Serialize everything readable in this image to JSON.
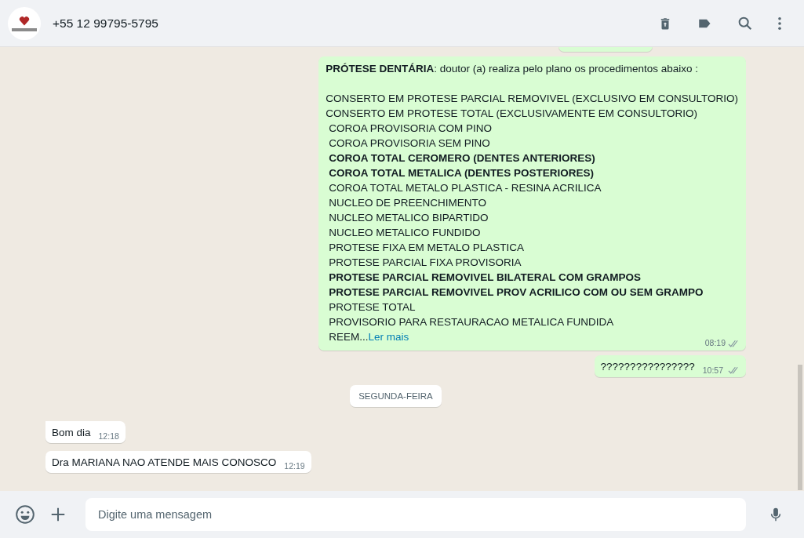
{
  "header": {
    "contact": "+55 12 99795-5795"
  },
  "messages": [
    {
      "kind": "cut"
    },
    {
      "kind": "long",
      "heading": "**PRÓTESE DENTÁRIA**: doutor (a) realiza pelo plano os procedimentos abaixo :",
      "lines": [
        {
          "text": "CONSERTO EM PROTESE PARCIAL REMOVIVEL (EXCLUSIVO EM CONSULTORIO)",
          "bold": false,
          "indent": false
        },
        {
          "text": "CONSERTO EM PROTESE TOTAL (EXCLUSIVAMENTE EM CONSULTORIO)",
          "bold": false,
          "indent": false
        },
        {
          "text": "COROA PROVISORIA COM PINO",
          "bold": false,
          "indent": true
        },
        {
          "text": "COROA PROVISORIA SEM PINO",
          "bold": false,
          "indent": true
        },
        {
          "text": "COROA TOTAL CEROMERO (DENTES ANTERIORES)",
          "bold": true,
          "indent": true
        },
        {
          "text": "COROA TOTAL METALICA (DENTES POSTERIORES)",
          "bold": true,
          "indent": true
        },
        {
          "text": "COROA TOTAL METALO PLASTICA - RESINA ACRILICA",
          "bold": false,
          "indent": true
        },
        {
          "text": "NUCLEO DE PREENCHIMENTO",
          "bold": false,
          "indent": true
        },
        {
          "text": "NUCLEO METALICO BIPARTIDO",
          "bold": false,
          "indent": true
        },
        {
          "text": "NUCLEO METALICO FUNDIDO",
          "bold": false,
          "indent": true
        },
        {
          "text": "PROTESE FIXA EM METALO PLASTICA",
          "bold": false,
          "indent": true
        },
        {
          "text": "PROTESE PARCIAL FIXA PROVISORIA",
          "bold": false,
          "indent": true
        },
        {
          "text": "PROTESE PARCIAL REMOVIVEL BILATERAL COM GRAMPOS",
          "bold": true,
          "indent": true
        },
        {
          "text": "PROTESE PARCIAL REMOVIVEL PROV ACRILICO COM OU SEM GRAMPO",
          "bold": true,
          "indent": true
        },
        {
          "text": "PROTESE TOTAL",
          "bold": false,
          "indent": true
        },
        {
          "text": "PROVISORIO PARA RESTAURACAO METALICA FUNDIDA",
          "bold": false,
          "indent": true
        }
      ],
      "truncated": "REEM...",
      "read_more": "Ler mais",
      "time": "08:19",
      "read": false
    },
    {
      "kind": "out",
      "text": "????????????????",
      "time": "10:57",
      "read": false
    },
    {
      "kind": "date",
      "text": "SEGUNDA-FEIRA"
    },
    {
      "kind": "in",
      "text": "Bom dia",
      "time": "12:18",
      "tail": true
    },
    {
      "kind": "in",
      "text": "Dra MARIANA NAO ATENDE MAIS CONOSCO",
      "time": "12:19",
      "tail": false
    }
  ],
  "composer": {
    "placeholder": "Digite uma mensagem"
  }
}
